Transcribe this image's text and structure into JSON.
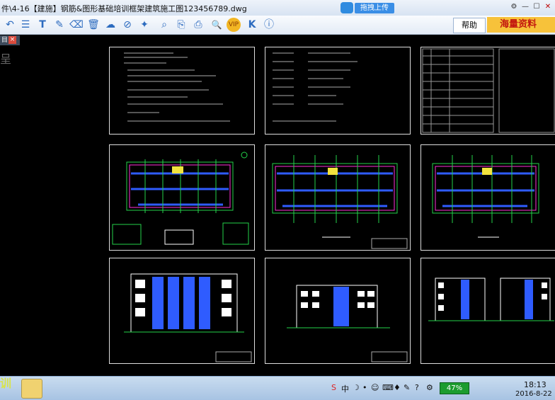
{
  "window": {
    "title": "件\\4-16【建施】钢筋&图形基础培训框架建筑施工图123456789.dwg",
    "upload_label": "拖拽上传",
    "controls": [
      "⚙",
      "—",
      "☐",
      "✕"
    ]
  },
  "toolbar": {
    "icons": [
      "undo-icon",
      "layout-icon",
      "text-icon",
      "pen-icon",
      "eraser-icon",
      "trash-icon",
      "cloud-icon",
      "cloud-hide-icon",
      "measure-icon",
      "zoom-icon",
      "copy-icon",
      "print-icon",
      "vip-icon",
      "k-icon",
      "info-icon"
    ],
    "vip_label": "VIP",
    "help_label": "帮助",
    "ad_label": "海量资料"
  },
  "sidebar": {
    "tab_label": "目",
    "close_label": "×",
    "glyph": "呈"
  },
  "taskbar": {
    "left_label": "训",
    "time": "18:13",
    "date": "2016-8-22",
    "battery": "47%",
    "tray_icons": [
      "S",
      "中",
      "☽",
      "•",
      "☺",
      "⌨",
      "♦",
      "✎",
      "?",
      "⚙"
    ]
  },
  "colors": {
    "accent": "#3a8ee6",
    "plan_green": "#24d24a",
    "plan_blue": "#2f5cff",
    "plan_magenta": "#ff2fd8",
    "plan_yellow": "#f1e23e"
  }
}
